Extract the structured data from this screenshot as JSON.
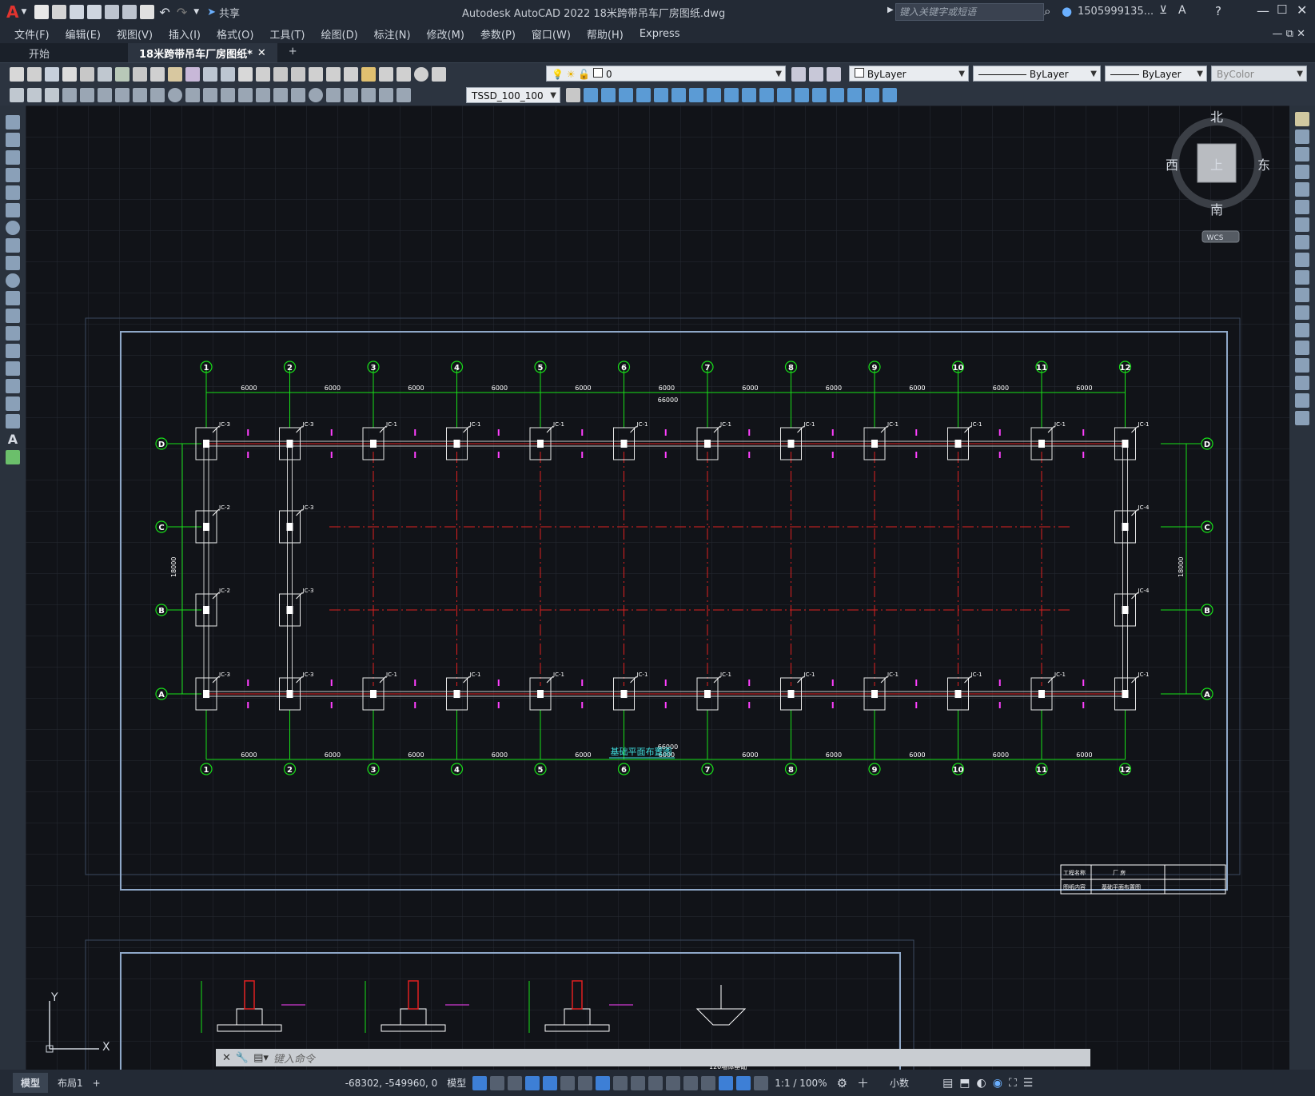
{
  "app": {
    "title": "Autodesk AutoCAD 2022    18米跨带吊车厂房图纸.dwg",
    "share_label": "共享",
    "search_placeholder": "键入关键字或短语",
    "user": "1505999135...",
    "logo": "A"
  },
  "menu": [
    "文件(F)",
    "编辑(E)",
    "视图(V)",
    "插入(I)",
    "格式(O)",
    "工具(T)",
    "绘图(D)",
    "标注(N)",
    "修改(M)",
    "参数(P)",
    "窗口(W)",
    "帮助(H)",
    "Express"
  ],
  "tabs": [
    {
      "label": "开始"
    },
    {
      "label": "18米跨带吊车厂房图纸*"
    }
  ],
  "toolbar": {
    "layer_value": "0",
    "color_value": "ByLayer",
    "linetype_value": "ByLayer",
    "lineweight_value": "ByLayer",
    "plotstyle_value": "ByColor",
    "dimstyle_value": "TSSD_100_100"
  },
  "viewcube": {
    "north": "北",
    "south": "南",
    "east": "东",
    "west": "西",
    "face": "上",
    "wcs": "WCS"
  },
  "drawing": {
    "title": "基础平面布置图",
    "axes_numbers": [
      "1",
      "2",
      "3",
      "4",
      "5",
      "6",
      "7",
      "8",
      "9",
      "10",
      "11",
      "12"
    ],
    "axes_letters": [
      "D",
      "C",
      "B",
      "A"
    ],
    "span_dim": "6000",
    "total_dim": "66000",
    "bay_dim_right": "18000",
    "bay_dim_left": "18000",
    "footing_label_1": "JC-1",
    "footing_label_2": "JC-2",
    "footing_label_3": "JC-3",
    "footing_label_4": "JC-4",
    "titleblock": {
      "project_label": "工程名称",
      "project_value": "厂  房",
      "drawing_label": "图纸内容",
      "drawing_value": "基础平面布置图"
    },
    "detail_caption": "120墙体基础"
  },
  "ucs": {
    "x": "X",
    "y": "Y"
  },
  "command": {
    "placeholder": "键入命令"
  },
  "status": {
    "layout_tabs": [
      "模型",
      "布局1"
    ],
    "coords": "-68302, -549960, 0",
    "model_label": "模型",
    "scale": "1:1 / 100%",
    "units": "小数"
  },
  "colors": {
    "green": "#18e018",
    "red": "#e02020",
    "magenta": "#ff40ff",
    "white": "#ffffff",
    "frame": "#8fa8c8"
  }
}
